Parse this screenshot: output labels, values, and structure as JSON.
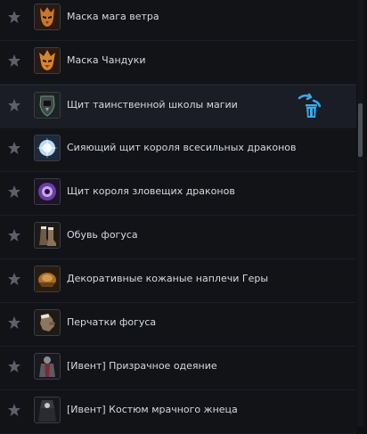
{
  "items": [
    {
      "label": "Маска мага ветра",
      "icon": "wind-mage-mask-icon"
    },
    {
      "label": "Маска Чандуки",
      "icon": "chanduki-mask-icon"
    },
    {
      "label": "Щит таинственной школы магии",
      "icon": "mystic-school-shield-icon",
      "selected": true
    },
    {
      "label": "Сияющий щит короля всесильных драконов",
      "icon": "radiant-dragon-king-shield-icon"
    },
    {
      "label": "Щит короля зловещих драконов",
      "icon": "sinister-dragon-king-shield-icon"
    },
    {
      "label": "Обувь фогуса",
      "icon": "fogus-boots-icon"
    },
    {
      "label": "Декоративные кожаные наплечи Геры",
      "icon": "hera-pauldrons-icon"
    },
    {
      "label": "Перчатки фогуса",
      "icon": "fogus-gloves-icon"
    },
    {
      "label": "[Ивент] Призрачное одеяние",
      "icon": "ghostly-robe-icon"
    },
    {
      "label": "[Ивент] Костюм мрачного жнеца",
      "icon": "grim-reaper-costume-icon"
    }
  ],
  "colors": {
    "background": "#111317",
    "selected_row": "#1a1d25",
    "accent_trash": "#3da8e8",
    "text": "#d6d9de"
  }
}
